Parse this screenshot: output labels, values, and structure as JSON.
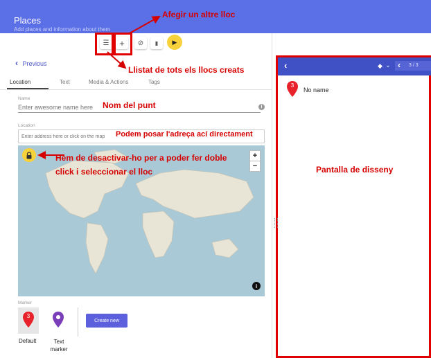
{
  "header": {
    "title": "Places",
    "subtitle": "Add places and information about them"
  },
  "toolbar": {
    "list_icon": "☰",
    "add_icon": "+",
    "hide_icon": "⊘",
    "delete_icon": "▮",
    "play_icon": "▶"
  },
  "nav": {
    "previous": "Previous",
    "chevron": "‹"
  },
  "tabs": [
    "Location",
    "Text",
    "Media & Actions",
    "Tags"
  ],
  "name_field": {
    "label": "Name",
    "placeholder": "Enter awesome name here",
    "info_icon": "i"
  },
  "location_field": {
    "label": "Location",
    "placeholder": "Enter address here or click on the map"
  },
  "map": {
    "zoom_in": "+",
    "zoom_out": "−",
    "info": "i"
  },
  "marker": {
    "label": "Marker",
    "options": [
      {
        "label": "Default",
        "badge": "3"
      },
      {
        "label": "Text marker"
      }
    ],
    "create_new": "Create new"
  },
  "preview": {
    "back": "‹",
    "page_prev": "‹",
    "page_counter": "3 / 3",
    "item_name": "No name",
    "item_badge": "3",
    "tags_icon": "◆",
    "dropdown": "⌄"
  },
  "annotations": {
    "add_place": "Afegir un altre lloc",
    "list_places": "Llistat de tots els llocs creats",
    "point_name": "Nom del punt",
    "address_here": "Podem posar l'adreça ací directament",
    "deactivate_line1": "Hem de desactivar-ho per a poder fer doble",
    "deactivate_line2": "click i seleccionar el lloc",
    "design_screen": "Pantalla de disseny"
  },
  "colors": {
    "header": "#5b6fe6",
    "annotation": "#d60000",
    "accent": "#5c60dd",
    "marker_red": "#e8222a",
    "marker_purple": "#7a3fb8"
  }
}
